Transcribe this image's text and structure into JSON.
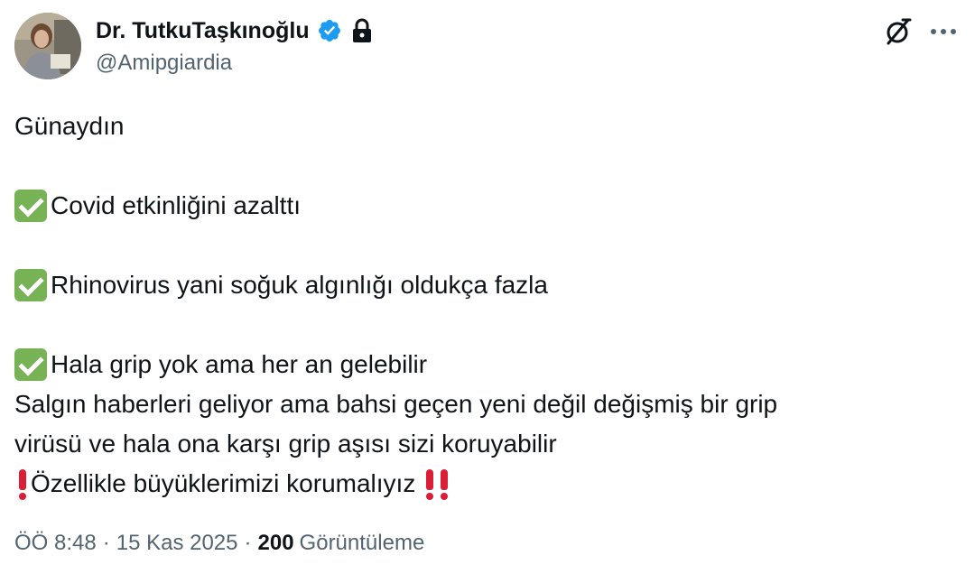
{
  "author": {
    "display_name": "Dr. TutkuTaşkınoğlu",
    "handle": "@Amipgiardia",
    "verified_icon": "verified-badge-icon",
    "protected_icon": "lock-icon",
    "badge_color": "#1d9bf0"
  },
  "header_actions": {
    "grok_icon": "grok-icon",
    "more_icon": "more-dots-icon"
  },
  "tweet": {
    "lines": [
      {
        "emoji": "",
        "text": "Günaydın"
      },
      {
        "emoji": "",
        "text": ""
      },
      {
        "emoji": "check-mark-button-emoji",
        "text": "Covid etkinliğini azalttı"
      },
      {
        "emoji": "",
        "text": ""
      },
      {
        "emoji": "check-mark-button-emoji",
        "text": "Rhinovirus yani soğuk algınlığı oldukça fazla"
      },
      {
        "emoji": "",
        "text": ""
      },
      {
        "emoji": "check-mark-button-emoji",
        "text": "Hala grip yok ama her an gelebilir"
      },
      {
        "emoji": "",
        "text": "Salgın haberleri geliyor ama bahsi geçen yeni değil değişmiş bir grip"
      },
      {
        "emoji": "",
        "text": "virüsü ve hala ona karşı grip aşısı sizi koruyabilir"
      },
      {
        "emoji": "exclamation-mark-emoji",
        "text": "Özellikle büyüklerimizi korumalıyız",
        "trailing_emoji": "double-exclamation-mark-emoji"
      }
    ]
  },
  "meta": {
    "time": "ÖÖ 8:48",
    "separator": "·",
    "date": "15 Kas 2025",
    "views_count": "200",
    "views_label": "Görüntüleme"
  },
  "colors": {
    "text_primary": "#0f1419",
    "text_secondary": "#536471",
    "check_green": "#77b255",
    "exclamation_red": "#d91e36"
  }
}
